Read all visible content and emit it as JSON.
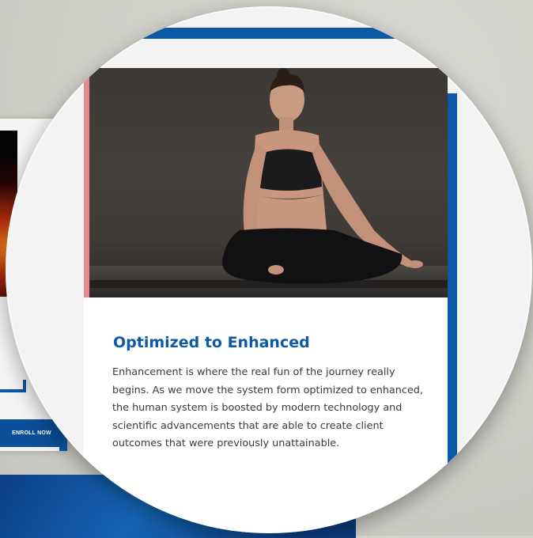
{
  "background": {
    "enroll_label": "ENROLL NOW"
  },
  "card": {
    "photo_alt": "Woman meditating in a seated yoga pose",
    "title": "Optimized to Enhanced",
    "body": "Enhancement is where the real fun of the journey really begins. As we move the system form optimized to enhanced, the human system is boosted by modern technology and scientific advancements that are able to create client outcomes that were previously unattainable."
  },
  "colors": {
    "brand_blue": "#0a58a6",
    "title_blue": "#0b5aa3",
    "accent_pink": "#e58a93"
  }
}
